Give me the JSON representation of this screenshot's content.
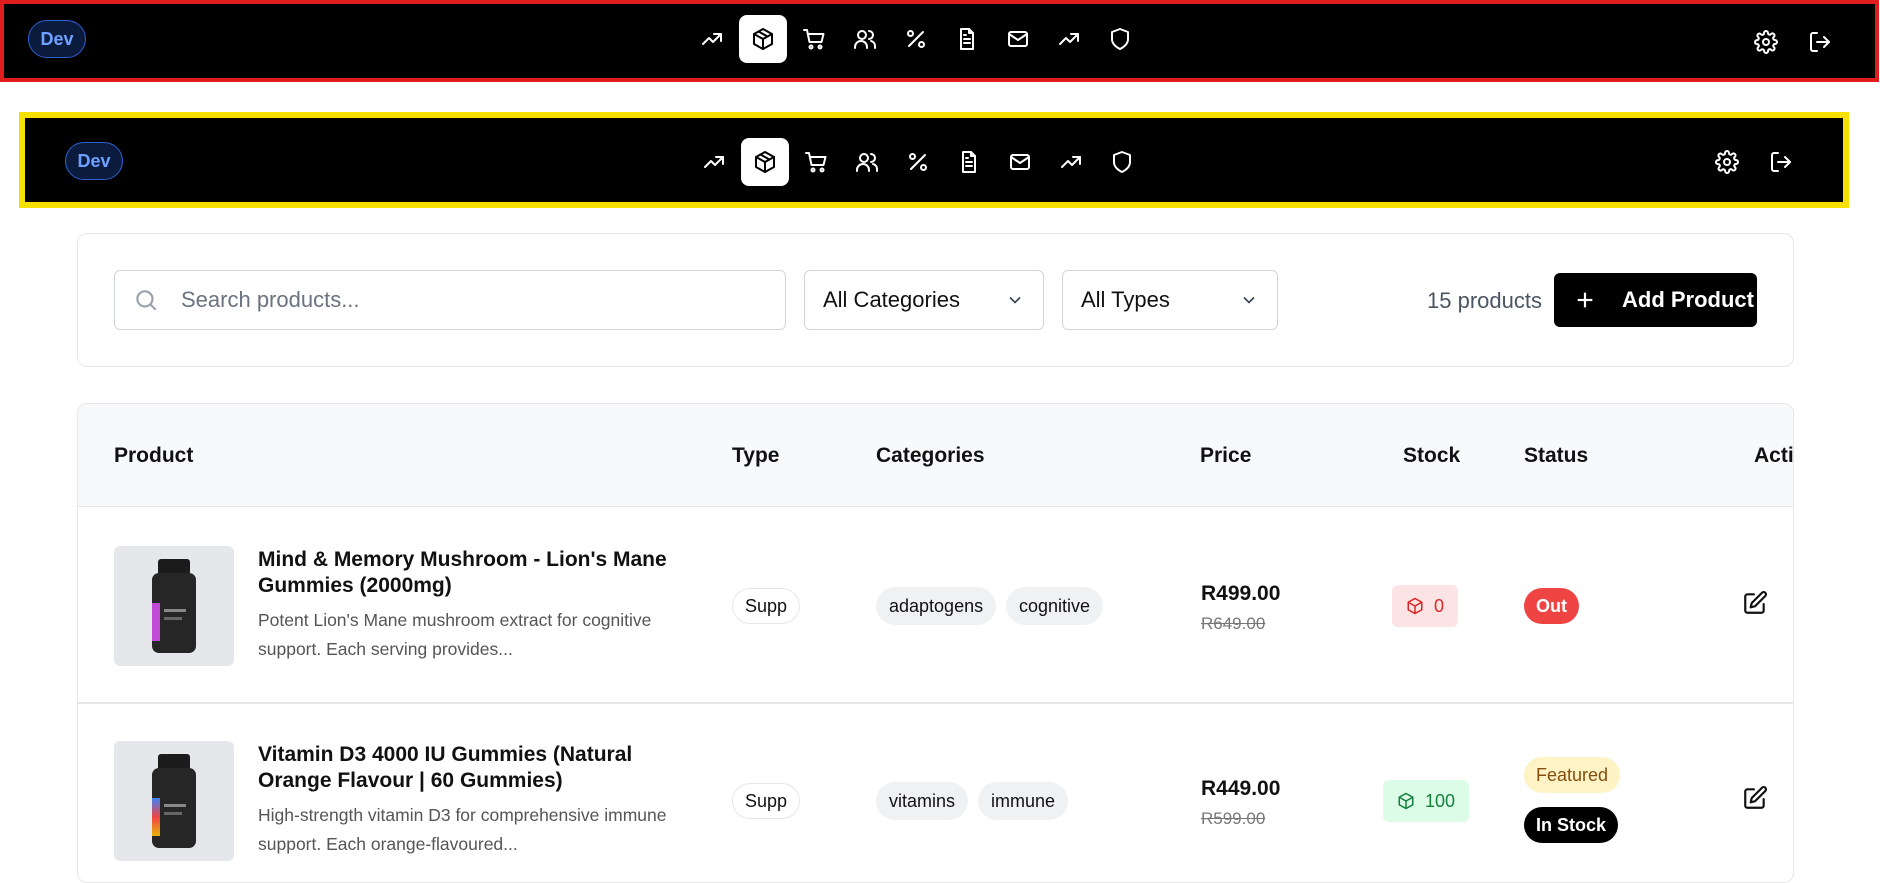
{
  "nav": {
    "dev_label": "Dev",
    "icons": [
      "trending-up-icon",
      "package-icon",
      "cart-icon",
      "users-icon",
      "percent-icon",
      "document-icon",
      "mail-icon",
      "trending-up-icon",
      "shield-icon"
    ],
    "active_index": 1,
    "right_icons": [
      "gear-icon",
      "logout-icon"
    ]
  },
  "toolbar": {
    "search_placeholder": "Search products...",
    "category_select": "All Categories",
    "type_select": "All Types",
    "count_text": "15 products",
    "add_label": "Add Product"
  },
  "table": {
    "headers": [
      "Product",
      "Type",
      "Categories",
      "Price",
      "Stock",
      "Status",
      "Actio"
    ],
    "rows": [
      {
        "title_line1": "Mind & Memory Mushroom - Lion's Mane",
        "title_line2": "Gummies (2000mg)",
        "desc_line1": "Potent Lion's Mane mushroom extract for cognitive",
        "desc_line2": "support. Each serving provides...",
        "type": "Supp",
        "categories": [
          "adaptogens",
          "cognitive"
        ],
        "price": "R499.00",
        "old_price": "R649.00",
        "stock": "0",
        "stock_color": "#dc2626",
        "statuses": [
          "Out"
        ]
      },
      {
        "title_line1": "Vitamin D3 4000 IU Gummies (Natural",
        "title_line2": "Orange Flavour | 60 Gummies)",
        "desc_line1": "High-strength vitamin D3 for comprehensive immune",
        "desc_line2": "support. Each orange-flavoured...",
        "type": "Supp",
        "categories": [
          "vitamins",
          "immune"
        ],
        "price": "R449.00",
        "old_price": "R599.00",
        "stock": "100",
        "stock_color": "#15803d",
        "statuses": [
          "Featured",
          "In Stock"
        ]
      }
    ]
  },
  "colors": {
    "nav_bg": "#000000",
    "red_outline": "#e11d1d",
    "yellow_outline": "#f5e000",
    "accent_blue": "#6ea0ff",
    "out_red": "#ef4444",
    "featured_bg": "#fdf3c4"
  }
}
